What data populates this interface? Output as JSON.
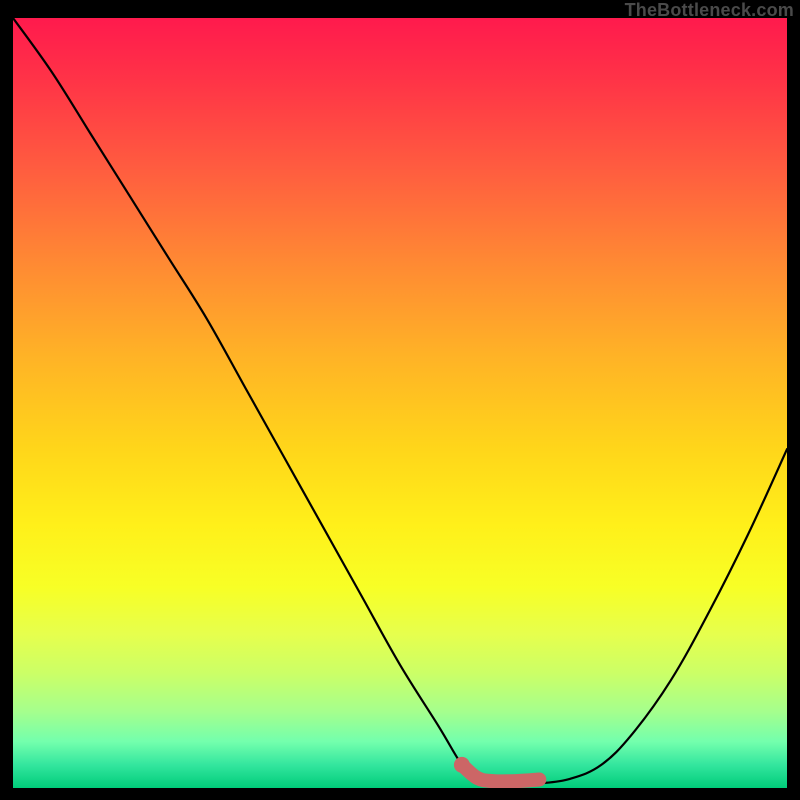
{
  "attribution": "TheBottleneck.com",
  "chart_data": {
    "type": "line",
    "title": "",
    "xlabel": "",
    "ylabel": "",
    "xlim": [
      0,
      100
    ],
    "ylim": [
      0,
      100
    ],
    "series": [
      {
        "name": "bottleneck-curve",
        "x": [
          0,
          5,
          10,
          15,
          20,
          25,
          30,
          35,
          40,
          45,
          50,
          55,
          58,
          60,
          62,
          65,
          68,
          72,
          76,
          80,
          85,
          90,
          95,
          100
        ],
        "values": [
          100,
          93,
          85,
          77,
          69,
          61,
          52,
          43,
          34,
          25,
          16,
          8,
          3,
          1,
          0.5,
          0.5,
          0.6,
          1.2,
          3,
          7,
          14,
          23,
          33,
          44
        ]
      },
      {
        "name": "highlight-segment",
        "x": [
          58,
          60,
          62,
          65,
          68
        ],
        "values": [
          3,
          1.3,
          0.9,
          0.9,
          1.1
        ]
      }
    ],
    "highlight_color": "#cc6666",
    "curve_color": "#000000"
  }
}
